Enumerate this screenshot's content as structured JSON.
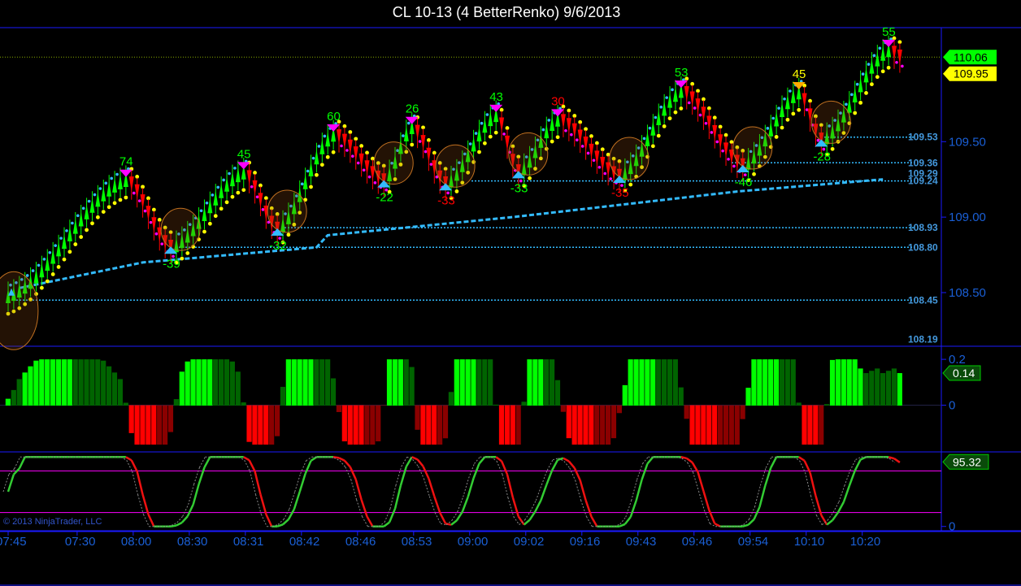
{
  "title": "CL 10-13 (4 BetterRenko)  9/6/2013",
  "copyright": "© 2013 NinjaTrader, LLC",
  "colors": {
    "up": "#00ff00",
    "down": "#ff0000",
    "dark_up": "#006400",
    "dark_down": "#8b0000",
    "yellow": "#ffff00",
    "magenta": "#ff00ff",
    "blue": "#33bbff",
    "frame": "#1a1aff"
  },
  "chart_data": [
    {
      "type": "line",
      "panel": "price",
      "ylim": [
        108.15,
        110.25
      ],
      "right_axis_ticks": [
        "108.50",
        "109.00",
        "109.50"
      ],
      "right_axis_tick_values": [
        108.5,
        109.0,
        109.5
      ],
      "last_price_labels": [
        {
          "text": "110.06",
          "value": 110.06,
          "color": "#00ff00"
        },
        {
          "text": "109.95",
          "value": 109.95,
          "color": "#ffff00"
        }
      ],
      "horizontal_levels": [
        {
          "text": "109.53",
          "value": 109.53
        },
        {
          "text": "109.36",
          "value": 109.36
        },
        {
          "text": "109.29",
          "value": 109.29
        },
        {
          "text": "109.24",
          "value": 109.24
        },
        {
          "text": "108.93",
          "value": 108.93
        },
        {
          "text": "108.80",
          "value": 108.8
        },
        {
          "text": "108.45",
          "value": 108.45
        },
        {
          "text": "108.19",
          "value": 108.19
        }
      ],
      "swing_labels": [
        {
          "text": "74",
          "bar": 21,
          "price": 109.25,
          "kind": "high"
        },
        {
          "text": "-39",
          "bar": 29,
          "price": 108.8,
          "kind": "low"
        },
        {
          "text": "45",
          "bar": 42,
          "price": 109.3,
          "kind": "high"
        },
        {
          "text": "-32",
          "bar": 48,
          "price": 108.92,
          "kind": "low"
        },
        {
          "text": "60",
          "bar": 58,
          "price": 109.55,
          "kind": "high"
        },
        {
          "text": "-22",
          "bar": 67,
          "price": 109.24,
          "kind": "low"
        },
        {
          "text": "26",
          "bar": 72,
          "price": 109.6,
          "kind": "high"
        },
        {
          "text": "-33",
          "bar": 78,
          "price": 109.22,
          "kind": "low"
        },
        {
          "text": "43",
          "bar": 87,
          "price": 109.68,
          "kind": "high"
        },
        {
          "text": "-33",
          "bar": 91,
          "price": 109.3,
          "kind": "low"
        },
        {
          "text": "30",
          "bar": 98,
          "price": 109.65,
          "kind": "high"
        },
        {
          "text": "-35",
          "bar": 109,
          "price": 109.27,
          "kind": "low"
        },
        {
          "text": "53",
          "bar": 120,
          "price": 109.84,
          "kind": "high"
        },
        {
          "text": "-46",
          "bar": 131,
          "price": 109.34,
          "kind": "low"
        },
        {
          "text": "45",
          "bar": 141,
          "price": 109.83,
          "kind": "high"
        },
        {
          "text": "-28",
          "bar": 145,
          "price": 109.51,
          "kind": "low"
        },
        {
          "text": "55",
          "bar": 157,
          "price": 110.11,
          "kind": "high"
        }
      ],
      "moving_average_anchors": [
        {
          "bar": 2,
          "price": 108.53
        },
        {
          "bar": 24,
          "price": 108.7
        },
        {
          "bar": 55,
          "price": 108.8
        },
        {
          "bar": 57,
          "price": 108.88
        },
        {
          "bar": 90,
          "price": 109.0
        },
        {
          "bar": 130,
          "price": 109.17
        },
        {
          "bar": 156,
          "price": 109.25
        }
      ]
    },
    {
      "type": "bar",
      "panel": "momentum",
      "ylim": [
        -0.2,
        0.25
      ],
      "right_axis_ticks": [
        "0.2",
        "0"
      ],
      "right_axis_tick_values": [
        0.2,
        0
      ],
      "last_value": "0.14"
    },
    {
      "type": "line",
      "panel": "stochastic",
      "ylim": [
        -5,
        105
      ],
      "right_axis_ticks": [
        "0"
      ],
      "right_axis_tick_values": [
        0
      ],
      "last_value": "95.32",
      "overbought": 80,
      "oversold": 20
    }
  ],
  "x_axis": {
    "labels": [
      "07:45",
      "07:30",
      "08:00",
      "08:30",
      "08:31",
      "08:42",
      "08:46",
      "08:53",
      "09:00",
      "09:02",
      "09:16",
      "09:43",
      "09:46",
      "09:54",
      "10:10",
      "10:20"
    ],
    "label_bars": [
      0,
      11,
      21,
      31,
      41,
      51,
      61,
      71,
      81,
      91,
      101,
      111,
      121,
      131,
      141,
      151
    ]
  }
}
